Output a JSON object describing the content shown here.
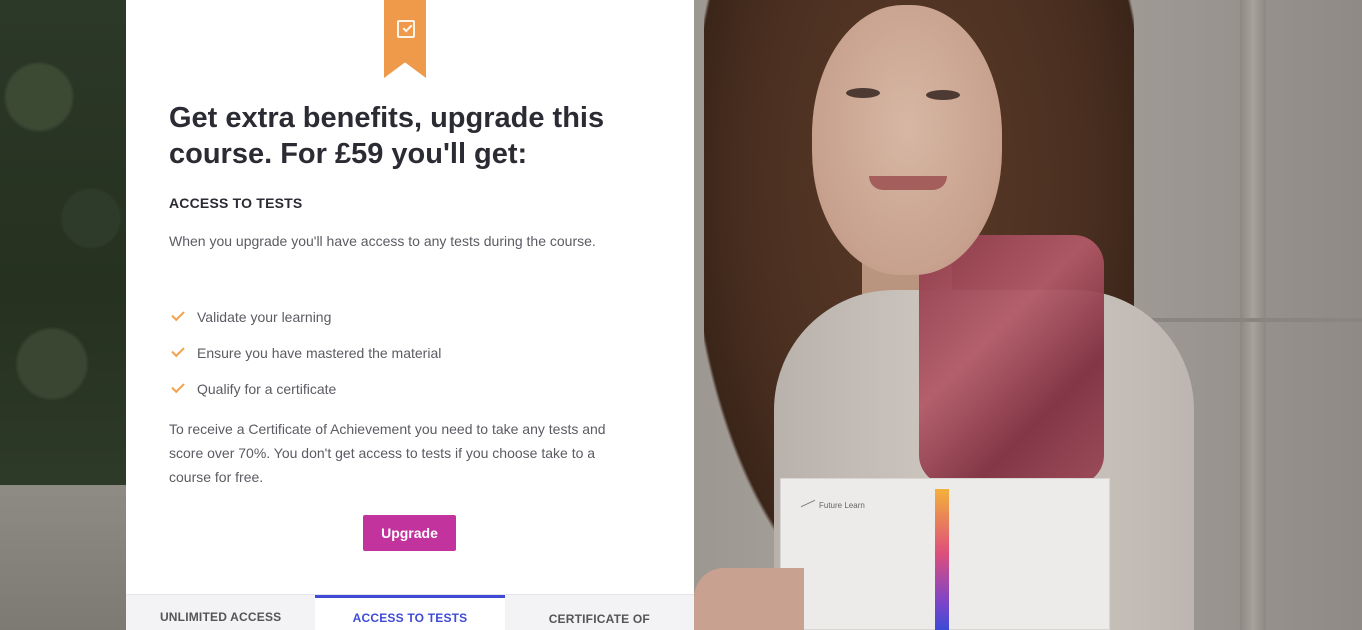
{
  "modal": {
    "title": "Get extra benefits, upgrade this course. For £59 you'll get:",
    "section_title": "ACCESS TO TESTS",
    "intro": "When you upgrade you'll have access to any tests during the course.",
    "benefits": [
      {
        "label": "Validate your learning",
        "icon": "check-icon"
      },
      {
        "label": "Ensure you have mastered the material",
        "icon": "check-icon"
      },
      {
        "label": "Qualify for a certificate",
        "icon": "check-icon"
      }
    ],
    "note": "To receive a Certificate of Achievement you need to take any tests and score over 70%. You don't get access to tests if you choose take to a course for free.",
    "upgrade_label": "Upgrade",
    "tabs": [
      {
        "label": "UNLIMITED ACCESS",
        "active": false
      },
      {
        "label": "ACCESS TO TESTS",
        "active": true
      },
      {
        "label": "CERTIFICATE OF",
        "active": false
      }
    ],
    "ribbon_icon": "checkbox-icon"
  },
  "certificate": {
    "logo_text": "Future Learn"
  },
  "colors": {
    "accent_button": "#c3339d",
    "active_tab": "#3f4bd6",
    "ribbon": "#ee9a4a",
    "check": "#f2a24a"
  }
}
